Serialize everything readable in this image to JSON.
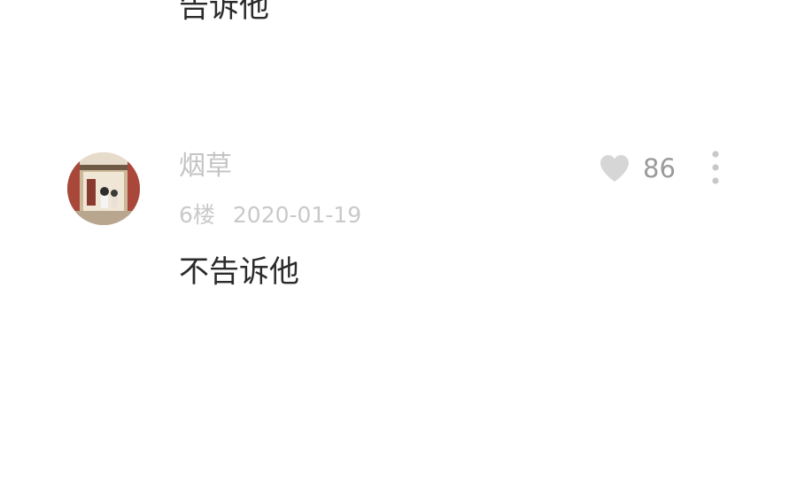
{
  "previous_comment": {
    "text": "告诉他"
  },
  "comment": {
    "username": "烟草",
    "floor": "6楼",
    "date": "2020-01-19",
    "text": "不告诉他",
    "likes": "86",
    "like_icon": "heart-icon",
    "more_icon": "more-vertical-icon"
  },
  "colors": {
    "background": "#ffffff",
    "text_primary": "#2b2b2b",
    "text_muted": "#c4c4c4",
    "icon_gray": "#d6d6d6"
  }
}
